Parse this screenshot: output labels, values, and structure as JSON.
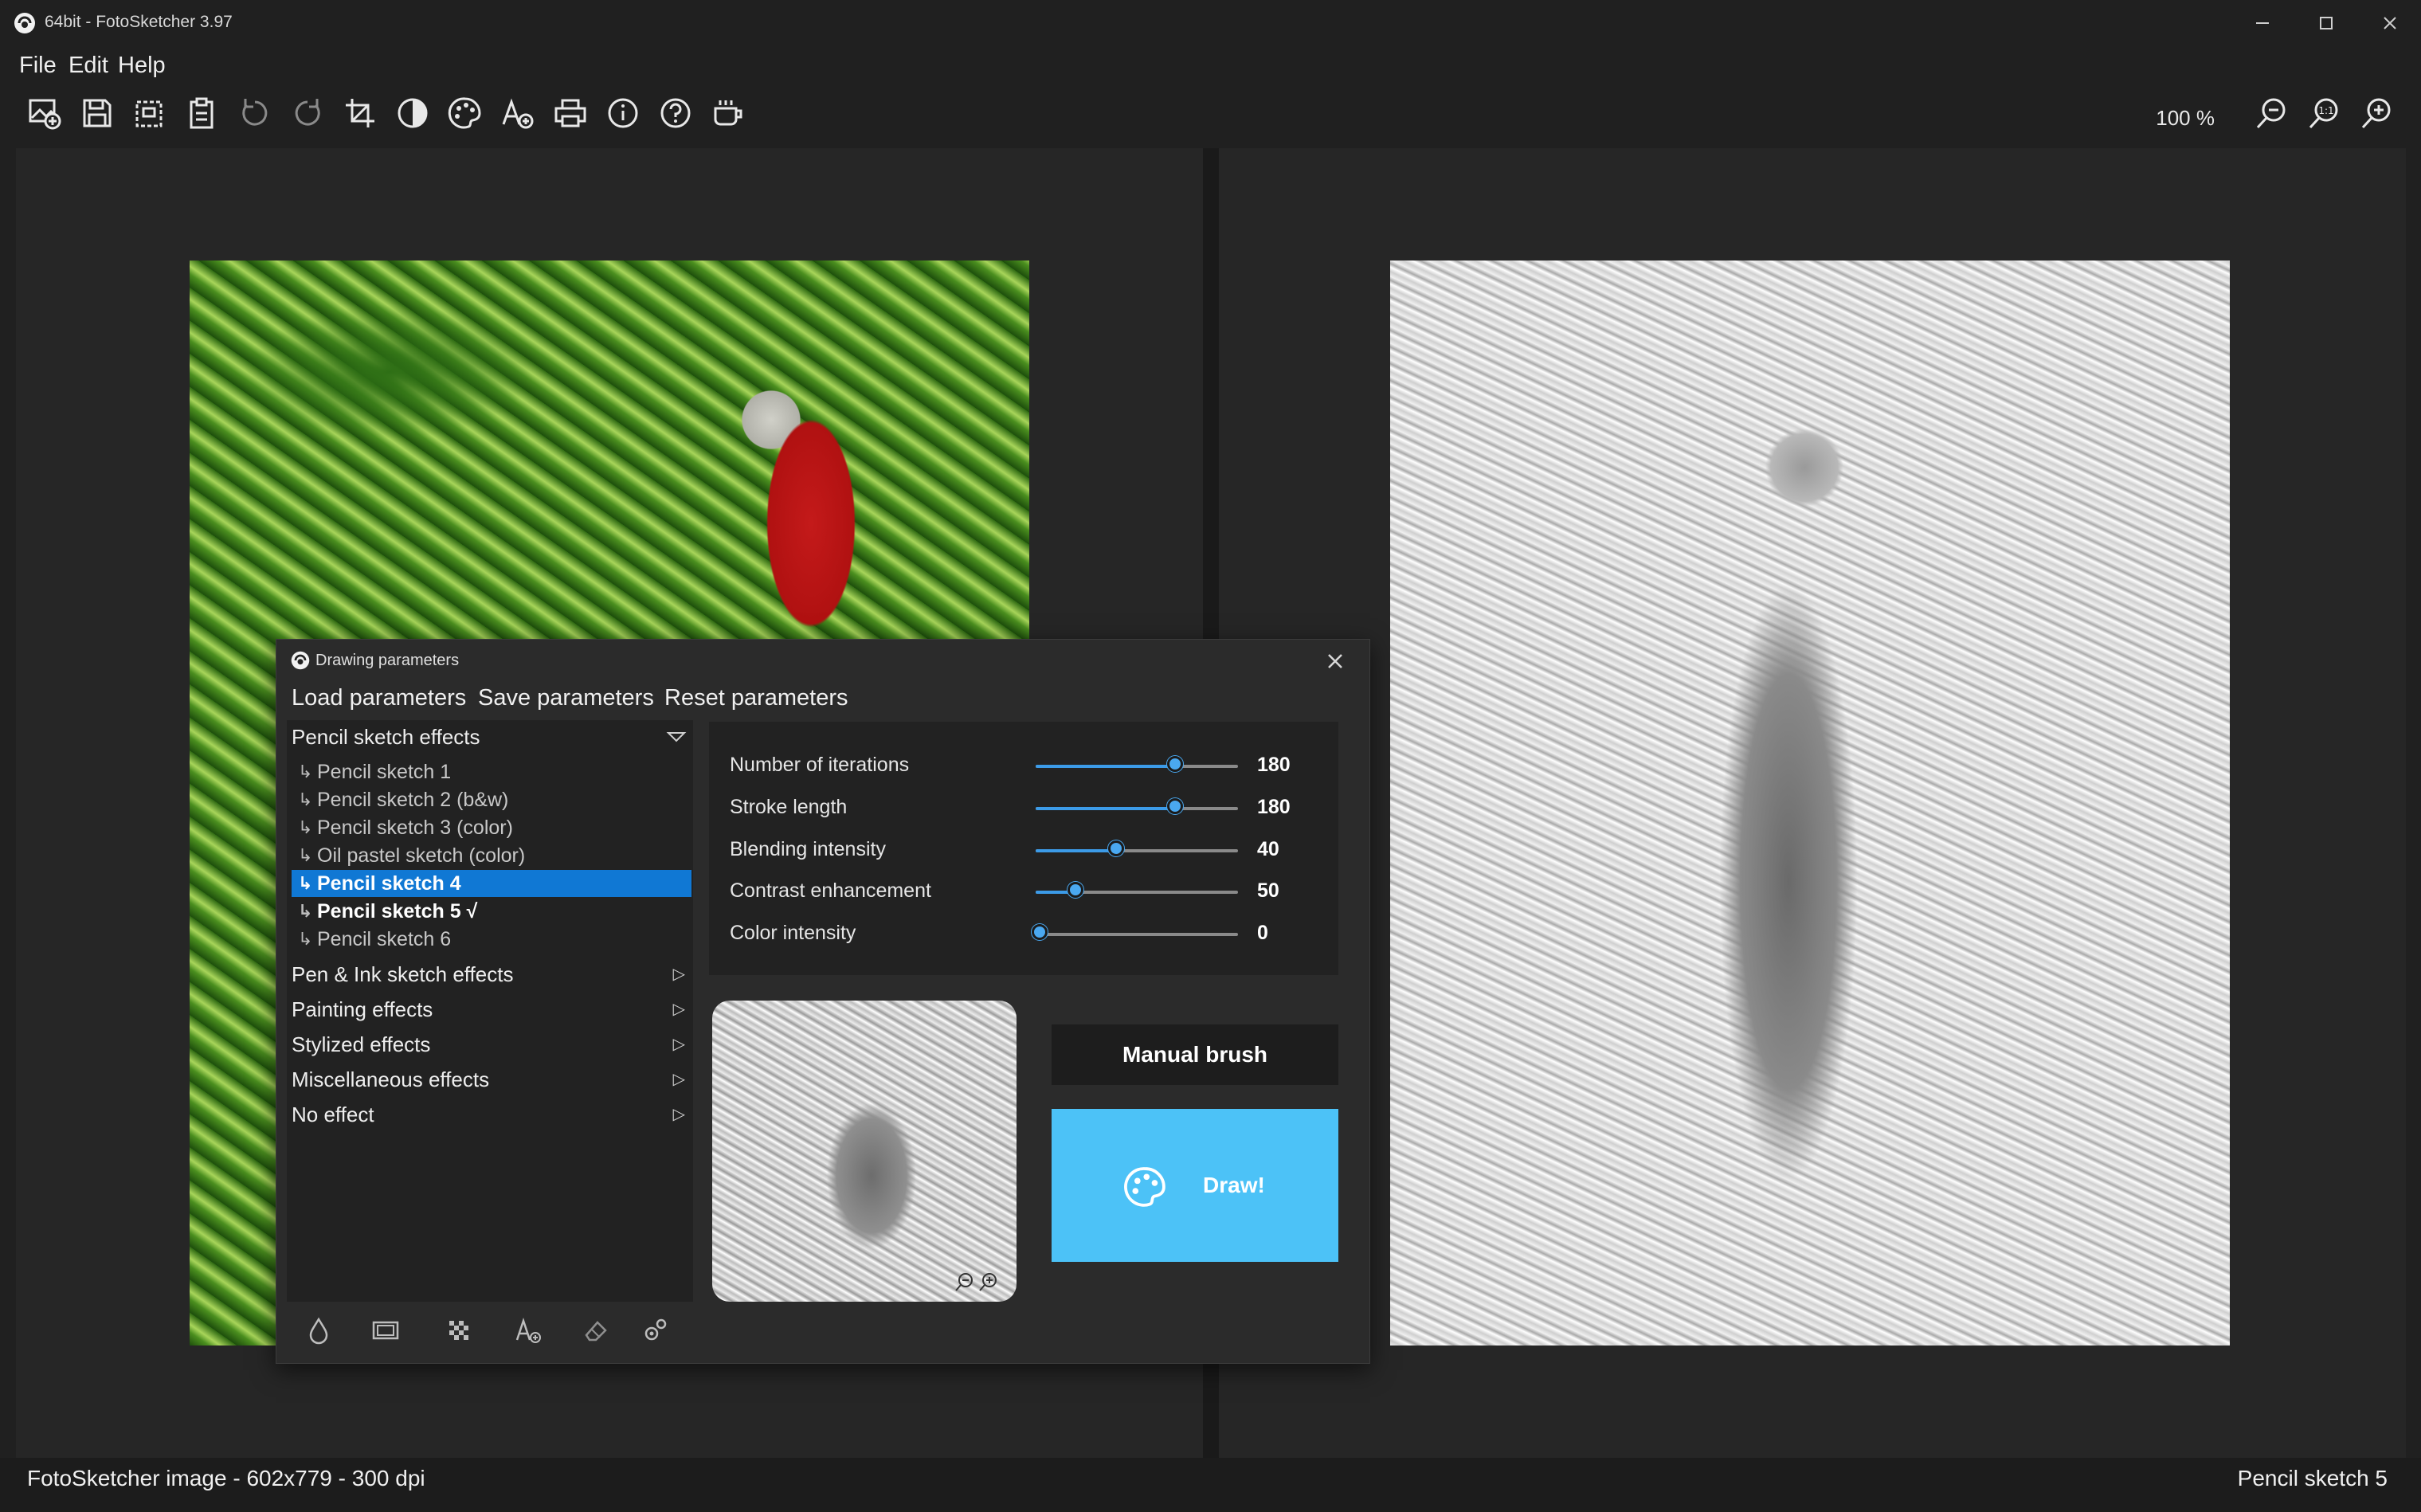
{
  "window": {
    "title": "64bit - FotoSketcher 3.97"
  },
  "menu": [
    "File",
    "Edit",
    "Help"
  ],
  "toolbar": {
    "icons": [
      "open-image-icon",
      "save-icon",
      "copy-icon",
      "paste-icon",
      "undo-icon",
      "redo-icon",
      "crop-icon",
      "contrast-icon",
      "palette-icon",
      "add-text-icon",
      "print-icon",
      "info-icon",
      "help-icon",
      "coffee-icon"
    ],
    "zoom_level": "100 %",
    "zoom_icons": [
      "zoom-out-icon",
      "zoom-actual-icon",
      "zoom-in-icon"
    ]
  },
  "dialog": {
    "title": "Drawing parameters",
    "menu": [
      "Load parameters",
      "Save parameters",
      "Reset parameters"
    ],
    "effects": {
      "header": "Pencil sketch effects",
      "items": [
        {
          "label": "Pencil sketch 1",
          "state": "normal"
        },
        {
          "label": "Pencil sketch 2 (b&w)",
          "state": "normal"
        },
        {
          "label": "Pencil sketch 3 (color)",
          "state": "normal"
        },
        {
          "label": "Oil pastel sketch (color)",
          "state": "normal"
        },
        {
          "label": "Pencil sketch 4",
          "state": "selected"
        },
        {
          "label": "Pencil sketch 5 √",
          "state": "current"
        },
        {
          "label": "Pencil sketch 6",
          "state": "normal"
        }
      ],
      "groups": [
        "Pen & Ink sketch effects",
        "Painting effects",
        "Stylized effects",
        "Miscellaneous effects",
        "No effect"
      ]
    },
    "parameters": [
      {
        "label": "Number of iterations",
        "value": "180",
        "level": 0.7
      },
      {
        "label": "Stroke length",
        "value": "180",
        "level": 0.7
      },
      {
        "label": "Blending intensity",
        "value": "40",
        "level": 0.41
      },
      {
        "label": "Contrast enhancement",
        "value": "50",
        "level": 0.21
      },
      {
        "label": "Color intensity",
        "value": "0",
        "level": 0.03
      }
    ],
    "bottom_tools": [
      "water-drop-icon",
      "frame-icon",
      "texture-icon",
      "add-text-icon",
      "eraser-icon",
      "settings-icon"
    ],
    "manual_brush": "Manual brush",
    "draw": "Draw!",
    "accent": "#4cc2f7",
    "selection_color": "#1078d4"
  },
  "status": {
    "left": "FotoSketcher image - 602x779 - 300 dpi",
    "right": "Pencil sketch 5"
  }
}
